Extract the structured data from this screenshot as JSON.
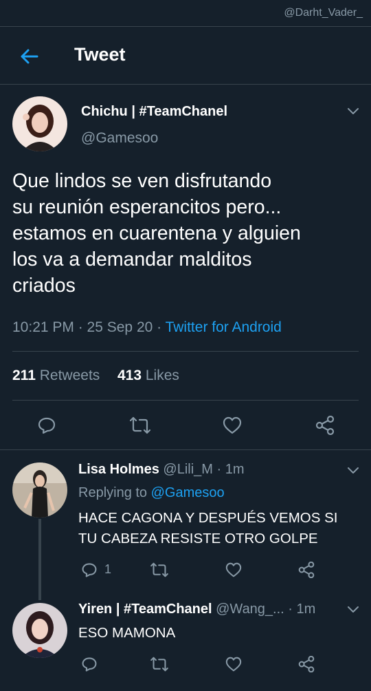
{
  "watermark": "@Darht_Vader_",
  "header": {
    "title": "Tweet"
  },
  "tweet": {
    "author_name": "Chichu | #TeamChanel",
    "handle": "@Gamesoo",
    "text_lines": [
      "Que lindos se ven disfrutando",
      "su reunión esperancitos pero...",
      "estamos en cuarentena y alguien",
      "los va a demandar malditos",
      "criados"
    ],
    "time": "10:21 PM · 25 Sep 20 · ",
    "source": "Twitter for Android",
    "retweets_count": "211",
    "retweets_label": "Retweets",
    "likes_count": "413",
    "likes_label": "Likes"
  },
  "replies": [
    {
      "name": "Lisa Holmes",
      "handle_time": "@Lili_M · 1m",
      "replying_to_label": "Replying to ",
      "replying_to_handle": "@Gamesoo",
      "text_lines": [
        "HACE CAGONA Y DESPUÉS VEMOS SI",
        "TU CABEZA RESISTE OTRO GOLPE"
      ],
      "reply_count": "1"
    },
    {
      "name": "Yiren | #TeamChanel",
      "handle_time": "@Wang_... · 1m",
      "text_lines": [
        "ESO MAMONA"
      ],
      "reply_count": ""
    }
  ],
  "colors": {
    "background": "#15202b",
    "accent": "#1da1f2",
    "muted": "#8899a6",
    "divider": "#38444d"
  },
  "icons": [
    "back-arrow-icon",
    "chevron-down-icon",
    "reply-icon",
    "retweet-icon",
    "like-icon",
    "share-icon"
  ]
}
